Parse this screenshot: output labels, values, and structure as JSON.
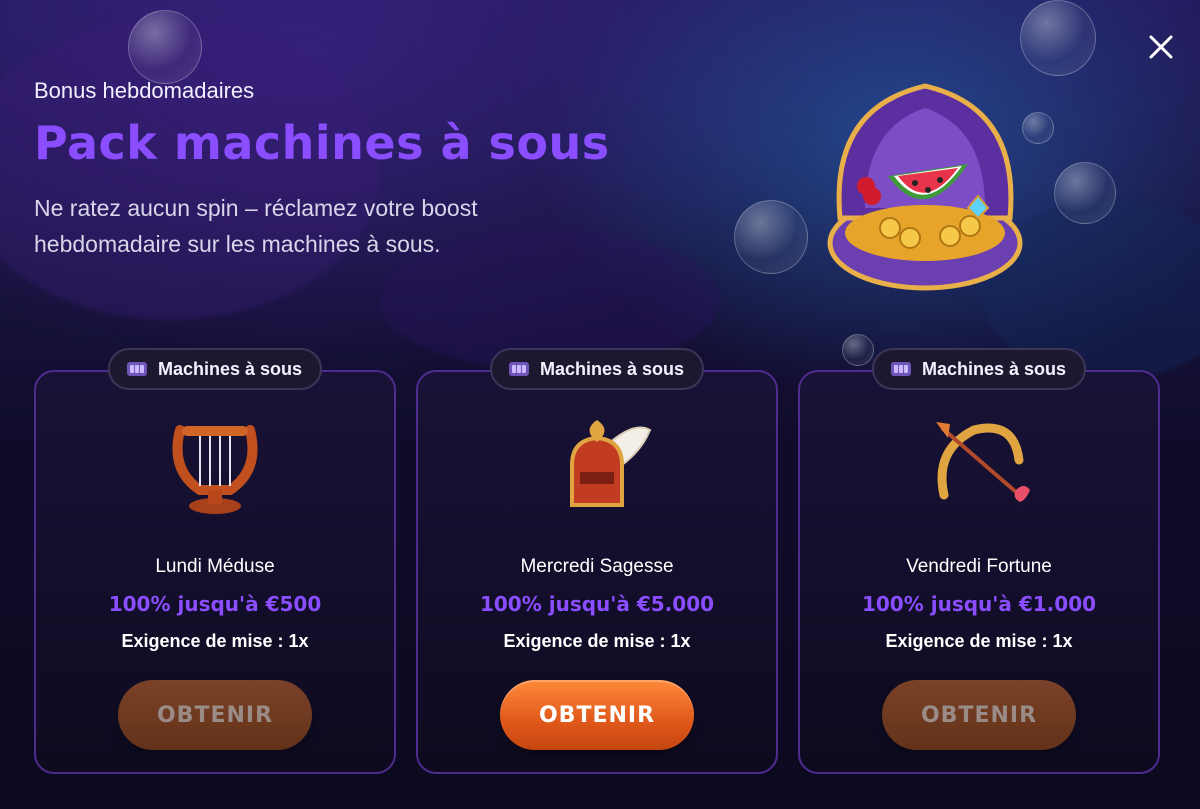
{
  "header": {
    "eyebrow": "Bonus hebdomadaires",
    "title": "Pack machines à sous",
    "description": "Ne ratez aucun spin – réclamez votre boost hebdomadaire sur les machines à sous."
  },
  "close_icon": "close-icon",
  "cards": [
    {
      "tag": "Machines à sous",
      "icon": "lyre-icon",
      "name": "Lundi Méduse",
      "offer": "100% jusqu'à €500",
      "wager": "Exigence de mise : 1x",
      "button": "OBTENIR",
      "button_state": "disabled"
    },
    {
      "tag": "Machines à sous",
      "icon": "winged-helmet-icon",
      "name": "Mercredi Sagesse",
      "offer": "100% jusqu'à €5.000",
      "wager": "Exigence de mise : 1x",
      "button": "OBTENIR",
      "button_state": "active"
    },
    {
      "tag": "Machines à sous",
      "icon": "bow-arrow-icon",
      "name": "Vendredi Fortune",
      "offer": "100% jusqu'à €1.000",
      "wager": "Exigence de mise : 1x",
      "button": "OBTENIR",
      "button_state": "disabled"
    }
  ],
  "colors": {
    "accent_purple": "#8a4dff",
    "button_orange": "#e0581b",
    "card_border": "#4e2c8f"
  }
}
